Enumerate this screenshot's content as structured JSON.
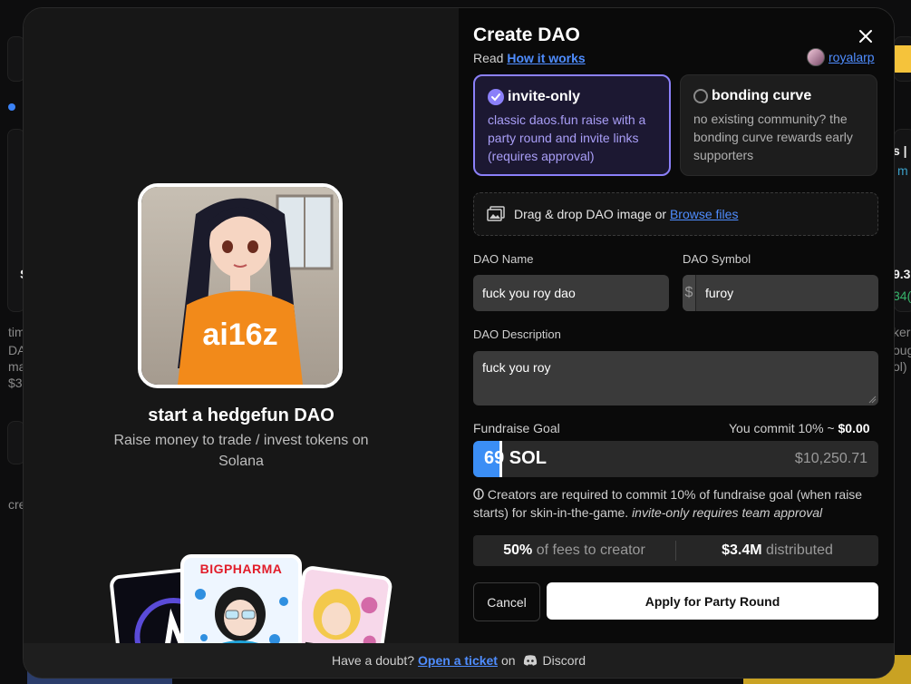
{
  "background": {
    "fragments": [
      "tim",
      "DA",
      "ma",
      "$3",
      "S",
      "cre",
      "s |",
      "m",
      "9.3",
      "34(",
      "ker",
      "oug",
      "ol)"
    ]
  },
  "modal": {
    "left": {
      "title": "start a hedgefun DAO",
      "subtitle": "Raise money to trade / invest tokens on Solana",
      "hero_text": "ai16z",
      "card_b_label": "BIGPHARMA"
    },
    "header": {
      "title": "Create DAO",
      "read_prefix": "Read",
      "how_link": "How it works",
      "username": "royalarp"
    },
    "options": [
      {
        "title": "invite-only",
        "desc": "classic daos.fun raise with a party round and invite links (requires approval)",
        "selected": true
      },
      {
        "title": "bonding curve",
        "desc": "no existing community? the bonding curve rewards early supporters",
        "selected": false
      }
    ],
    "dropzone": {
      "text": "Drag & drop DAO image or",
      "link": "Browse files"
    },
    "form": {
      "name_label": "DAO Name",
      "name_value": "fuck you roy dao",
      "symbol_label": "DAO Symbol",
      "symbol_prefix": "$",
      "symbol_value": "furoy",
      "desc_label": "DAO Description",
      "desc_value": "fuck you roy",
      "goal_label": "Fundraise Goal",
      "commit_prefix": "You commit 10% ~",
      "commit_value": "$0.00",
      "goal_value": "69 SOL",
      "goal_fill_fraction": 0.065,
      "goal_usd": "$10,250.71",
      "note_main": "Creators are required to commit 10% of fundraise goal (when raise starts) for skin-in-the-game.",
      "note_italic": "invite-only requires team approval"
    },
    "stats": {
      "fees_value": "50%",
      "fees_label": "of fees to creator",
      "dist_value": "$3.4M",
      "dist_label": "distributed"
    },
    "buttons": {
      "cancel": "Cancel",
      "apply": "Apply for Party Round"
    },
    "footer": {
      "prefix": "Have a doubt?",
      "link": "Open a ticket",
      "on": "on",
      "platform": "Discord"
    }
  },
  "colors": {
    "accent_purple": "#8b80f9",
    "link_blue": "#4f8dff",
    "goal_blue": "#3b8ef5"
  }
}
